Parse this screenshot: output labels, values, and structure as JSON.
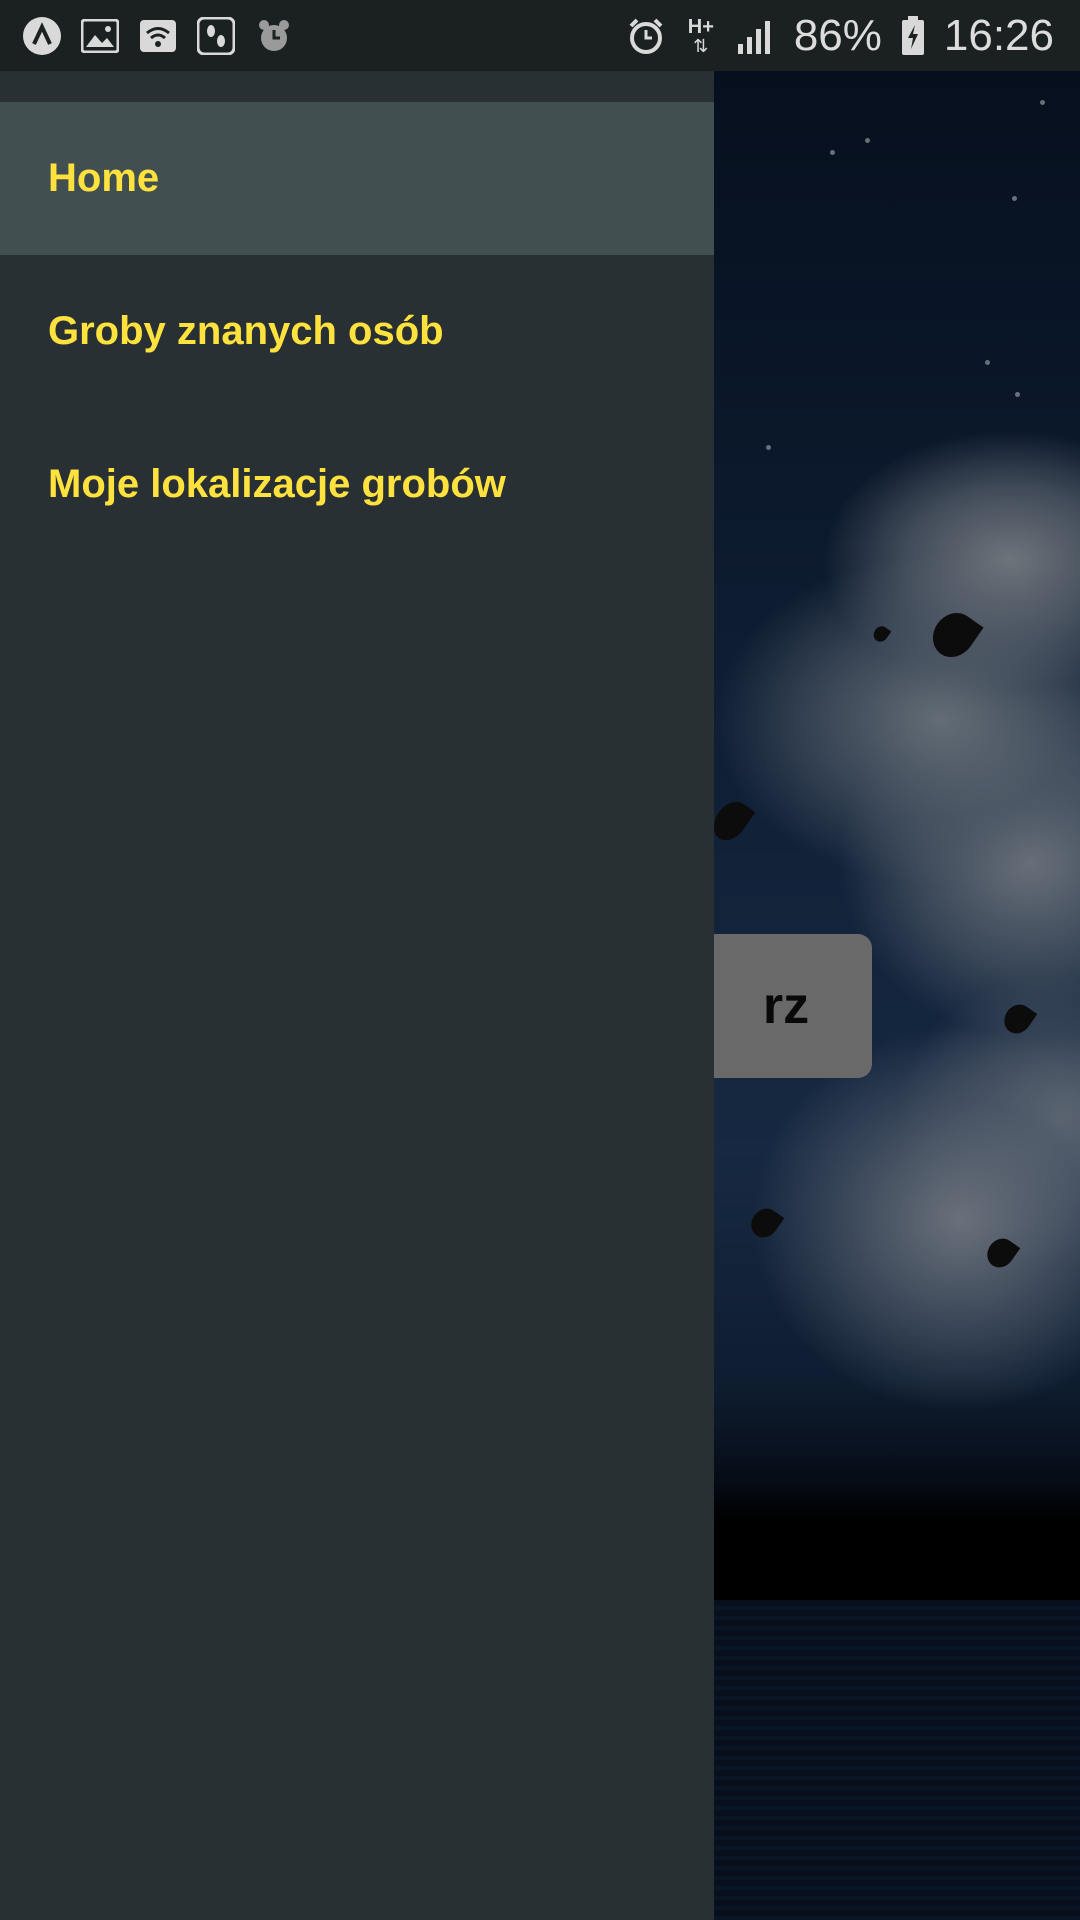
{
  "status_bar": {
    "left_icons": [
      "app-a-icon",
      "gallery-icon",
      "wifi-box-icon",
      "footsteps-icon",
      "alarm-clock-icon"
    ],
    "right_icons": [
      "alarm-icon",
      "mobile-data-icon",
      "signal-icon",
      "battery-charging-icon"
    ],
    "data_type": "H+",
    "battery": "86%",
    "time": "16:26"
  },
  "drawer": {
    "items": [
      {
        "label": "Home",
        "active": true
      },
      {
        "label": "Groby znanych osób",
        "active": false
      },
      {
        "label": "Moje lokalizacje grobów",
        "active": false
      }
    ]
  },
  "background": {
    "button_visible_text": "rz"
  },
  "colors": {
    "drawer_bg": "#283033",
    "active_item_bg": "#424f50",
    "label_yellow": "#ffe23e",
    "status_bar_bg": "#1b2020"
  }
}
